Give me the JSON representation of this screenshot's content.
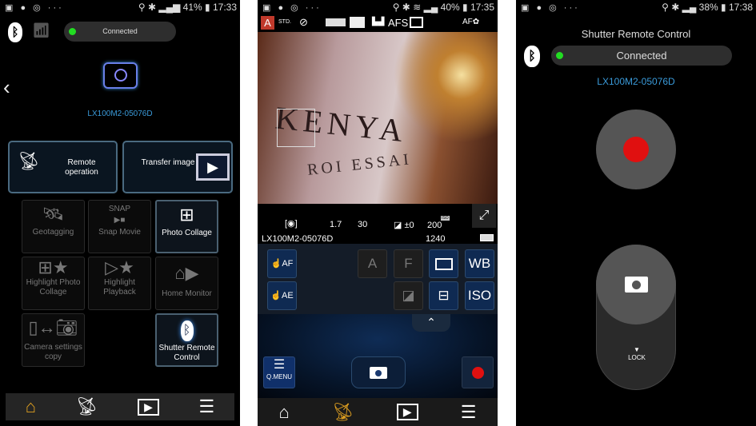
{
  "screen1": {
    "status": {
      "left_icons": "▣ ● ◎ ···",
      "battery": "41%",
      "time": "17:33"
    },
    "connection": {
      "status": "Connected"
    },
    "device_name": "LX100M2-05076D",
    "big_buttons": [
      {
        "label": "Remote operation",
        "icon": "remote-icon"
      },
      {
        "label": "Transfer image",
        "icon": "play-icon"
      }
    ],
    "tiles": [
      {
        "label": "Geotagging",
        "icon": "satellite-icon",
        "enabled": false
      },
      {
        "label": "Snap Movie",
        "icon": "snap-movie-icon",
        "sublabel": "SNAP",
        "enabled": false
      },
      {
        "label": "Photo Collage",
        "icon": "collage-icon",
        "enabled": true
      },
      {
        "label": "Highlight Photo Collage",
        "icon": "highlight-collage-icon",
        "enabled": false
      },
      {
        "label": "Highlight Playback",
        "icon": "highlight-playback-icon",
        "enabled": false
      },
      {
        "label": "Home Monitor",
        "icon": "home-monitor-icon",
        "enabled": false
      },
      {
        "label": "Camera settings copy",
        "icon": "settings-copy-icon",
        "enabled": false
      },
      {
        "label": "Shutter Remote Control",
        "icon": "bluetooth-icon",
        "enabled": true
      }
    ],
    "nav": {
      "active": "home"
    }
  },
  "screen2": {
    "status": {
      "left_icons": "▣ ● ◎ ···",
      "battery": "40%",
      "time": "17:35"
    },
    "top_icons": {
      "mode": "A",
      "style": "STD.",
      "focus_mode": "AFS",
      "af_macro": "AF✿"
    },
    "photo_text": [
      "KENYA",
      "ROI ESSAI"
    ],
    "info": {
      "aperture": "1.7",
      "shutter": "30",
      "exposure": "±0",
      "iso": "200",
      "iso_badge": "ISO",
      "device": "LX100M2-05076D",
      "remaining": "1240"
    },
    "controls": {
      "touch_af": "AF",
      "touch_ae": "AE",
      "a": "A",
      "f": "F",
      "wb": "WB",
      "iso": "ISO"
    },
    "qmenu": "Q.MENU",
    "nav": {
      "active": "remote"
    }
  },
  "screen3": {
    "status": {
      "left_icons": "▣ ● ◎ ···",
      "battery": "38%",
      "time": "17:38"
    },
    "title": "Shutter Remote Control",
    "connection": {
      "status": "Connected"
    },
    "device_name": "LX100M2-05076D",
    "lock_label": "LOCK"
  },
  "colors": {
    "accent_blue": "#3a9ad9",
    "connected_green": "#22dd22",
    "record_red": "#e01010",
    "active_nav": "#e0a020"
  }
}
